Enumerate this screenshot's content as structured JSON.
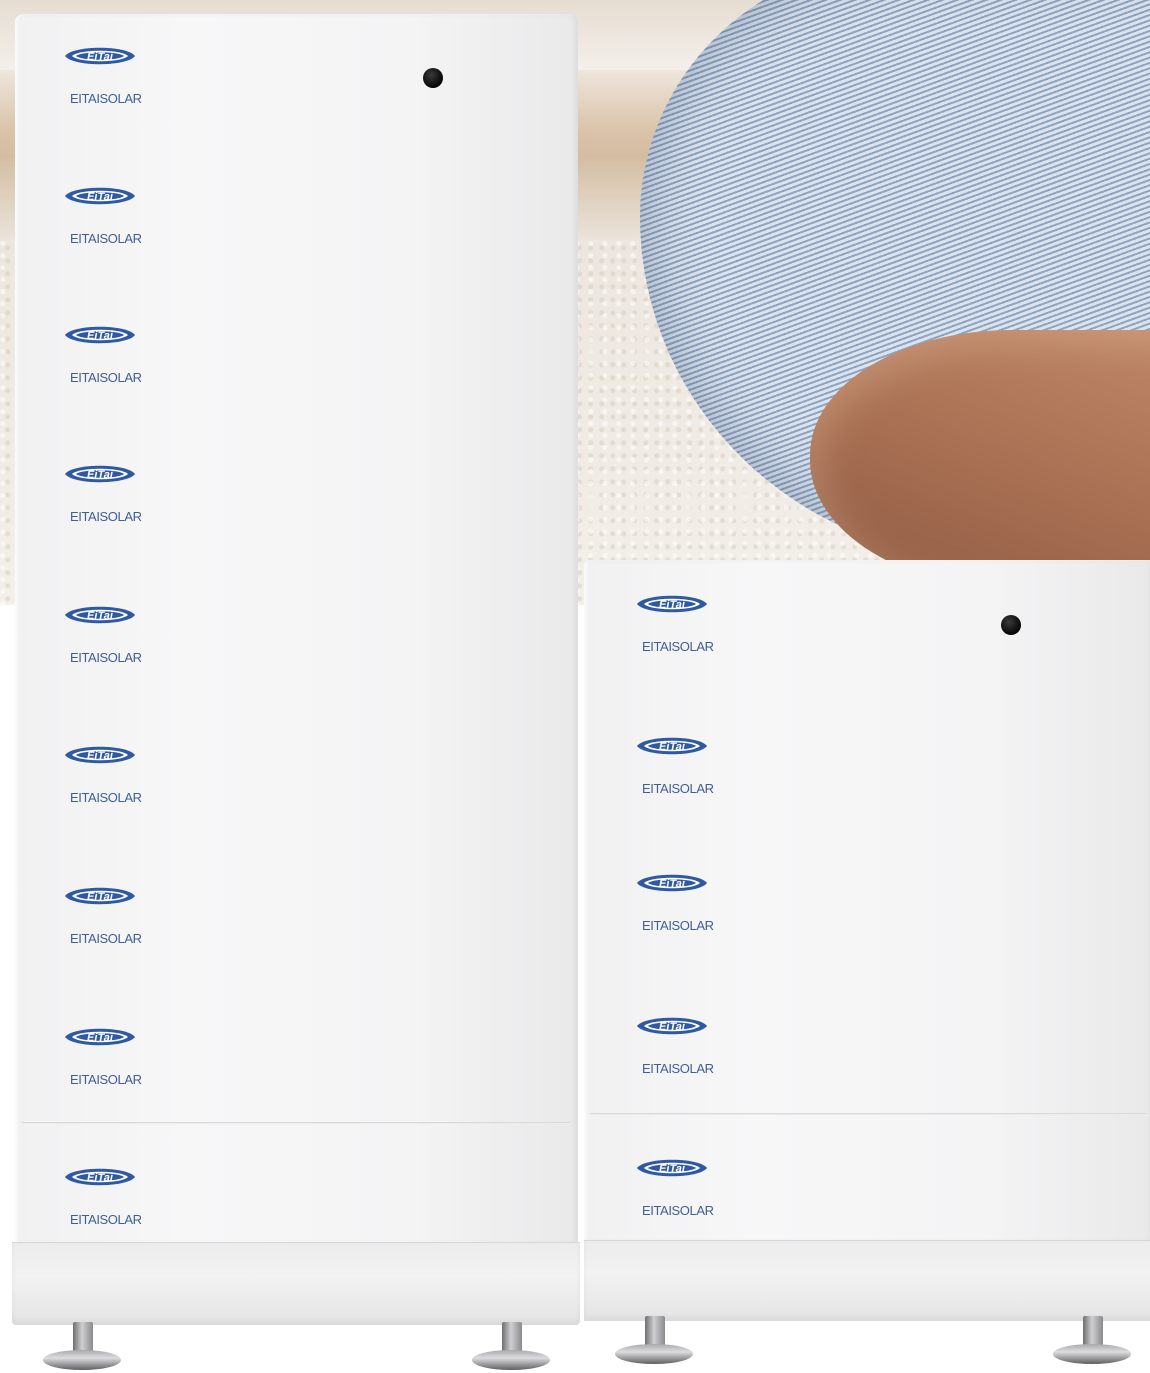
{
  "product": {
    "brand_text": "EITAISOLAR",
    "logo_text": "EiTai",
    "accent_color": "#2f5aa3"
  },
  "units": [
    {
      "name": "tall-stack",
      "modules": [
        {
          "brand": "EITAISOLAR",
          "logo": "EiTai"
        },
        {
          "brand": "EITAISOLAR",
          "logo": "EiTai"
        },
        {
          "brand": "EITAISOLAR",
          "logo": "EiTai"
        },
        {
          "brand": "EITAISOLAR",
          "logo": "EiTai"
        },
        {
          "brand": "EITAISOLAR",
          "logo": "EiTai"
        },
        {
          "brand": "EITAISOLAR",
          "logo": "EiTai"
        },
        {
          "brand": "EITAISOLAR",
          "logo": "EiTai"
        },
        {
          "brand": "EITAISOLAR",
          "logo": "EiTai"
        },
        {
          "brand": "EITAISOLAR",
          "logo": "EiTai"
        }
      ]
    },
    {
      "name": "short-stack",
      "modules": [
        {
          "brand": "EITAISOLAR",
          "logo": "EiTai"
        },
        {
          "brand": "EITAISOLAR",
          "logo": "EiTai"
        },
        {
          "brand": "EITAISOLAR",
          "logo": "EiTai"
        },
        {
          "brand": "EITAISOLAR",
          "logo": "EiTai"
        },
        {
          "brand": "EITAISOLAR",
          "logo": "EiTai"
        }
      ]
    }
  ]
}
